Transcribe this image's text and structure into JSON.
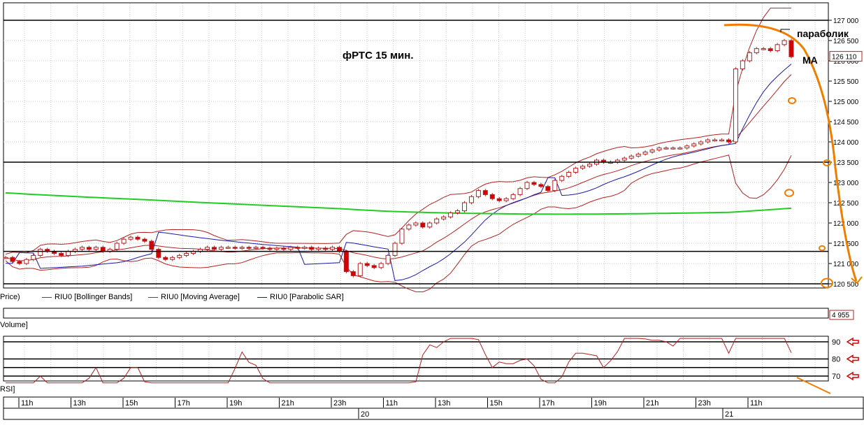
{
  "chart_data": {
    "type": "candlestick",
    "title": "фРТС   15 мин.",
    "annotations": {
      "parabolic": "параболик",
      "ma": "МА"
    },
    "price_axis": {
      "ylim": [
        120500,
        127000
      ],
      "ticks": [
        "127 000",
        "126 500",
        "126 000",
        "125 500",
        "125 000",
        "124 500",
        "124 000",
        "123 500",
        "123 000",
        "122 500",
        "122 000",
        "121 500",
        "121 000",
        "120 500"
      ],
      "tick_values": [
        127000,
        126500,
        126000,
        125500,
        125000,
        124500,
        124000,
        123500,
        123000,
        122500,
        122000,
        121500,
        121000,
        120500
      ],
      "current_price": "126 110"
    },
    "horizontal_levels": [
      127000,
      123500,
      121300,
      120500
    ],
    "price_legend": [
      {
        "label": "Price)",
        "color": "#000000"
      },
      {
        "label": "RIU0 [Bollinger Bands]",
        "color": "#b22222"
      },
      {
        "label": "RIU0 [Moving Average]",
        "color": "#b22222"
      },
      {
        "label": "RIU0 [Parabolic SAR]",
        "color": "#1a1aa8"
      }
    ],
    "volume_panel": {
      "label": "Volume]",
      "value": "4 955"
    },
    "rsi_panel": {
      "label": "RSI]",
      "ticks": [
        "90",
        "80",
        "70"
      ],
      "tick_values": [
        90,
        80,
        70
      ],
      "levels": [
        90,
        80,
        75,
        70
      ]
    },
    "time_axis": {
      "hour_labels": [
        "11h",
        "13h",
        "15h",
        "17h",
        "19h",
        "21h",
        "23h",
        "11h",
        "13h",
        "15h",
        "17h",
        "19h",
        "21h",
        "23h",
        "11h"
      ],
      "day_labels": [
        "20",
        "21"
      ]
    },
    "series": {
      "close": [
        121150,
        121050,
        121000,
        121100,
        121200,
        121350,
        121300,
        121250,
        121200,
        121300,
        121350,
        121400,
        121350,
        121400,
        121300,
        121350,
        121500,
        121600,
        121650,
        121600,
        121550,
        121350,
        121150,
        121100,
        121150,
        121200,
        121250,
        121300,
        121350,
        121400,
        121350,
        121400,
        121400,
        121380,
        121400,
        121380,
        121400,
        121380,
        121350,
        121380,
        121350,
        121400,
        121380,
        121400,
        121350,
        121380,
        121350,
        121400,
        121300,
        120800,
        120700,
        121000,
        120950,
        120900,
        121000,
        121200,
        121500,
        121850,
        121950,
        122000,
        121900,
        122000,
        122100,
        122150,
        122250,
        122300,
        122500,
        122650,
        122800,
        122700,
        122600,
        122550,
        122600,
        122700,
        122850,
        123000,
        122950,
        122900,
        122800,
        123050,
        123150,
        123250,
        123350,
        123400,
        123450,
        123550,
        123500,
        123500,
        123550,
        123600,
        123650,
        123700,
        123750,
        123800,
        123850,
        123850,
        123850,
        123850,
        123900,
        123950,
        124000,
        124050,
        124050,
        124050,
        124000,
        125800,
        126000,
        126200,
        126300,
        126300,
        126250,
        126400,
        126500,
        126100
      ]
    }
  }
}
